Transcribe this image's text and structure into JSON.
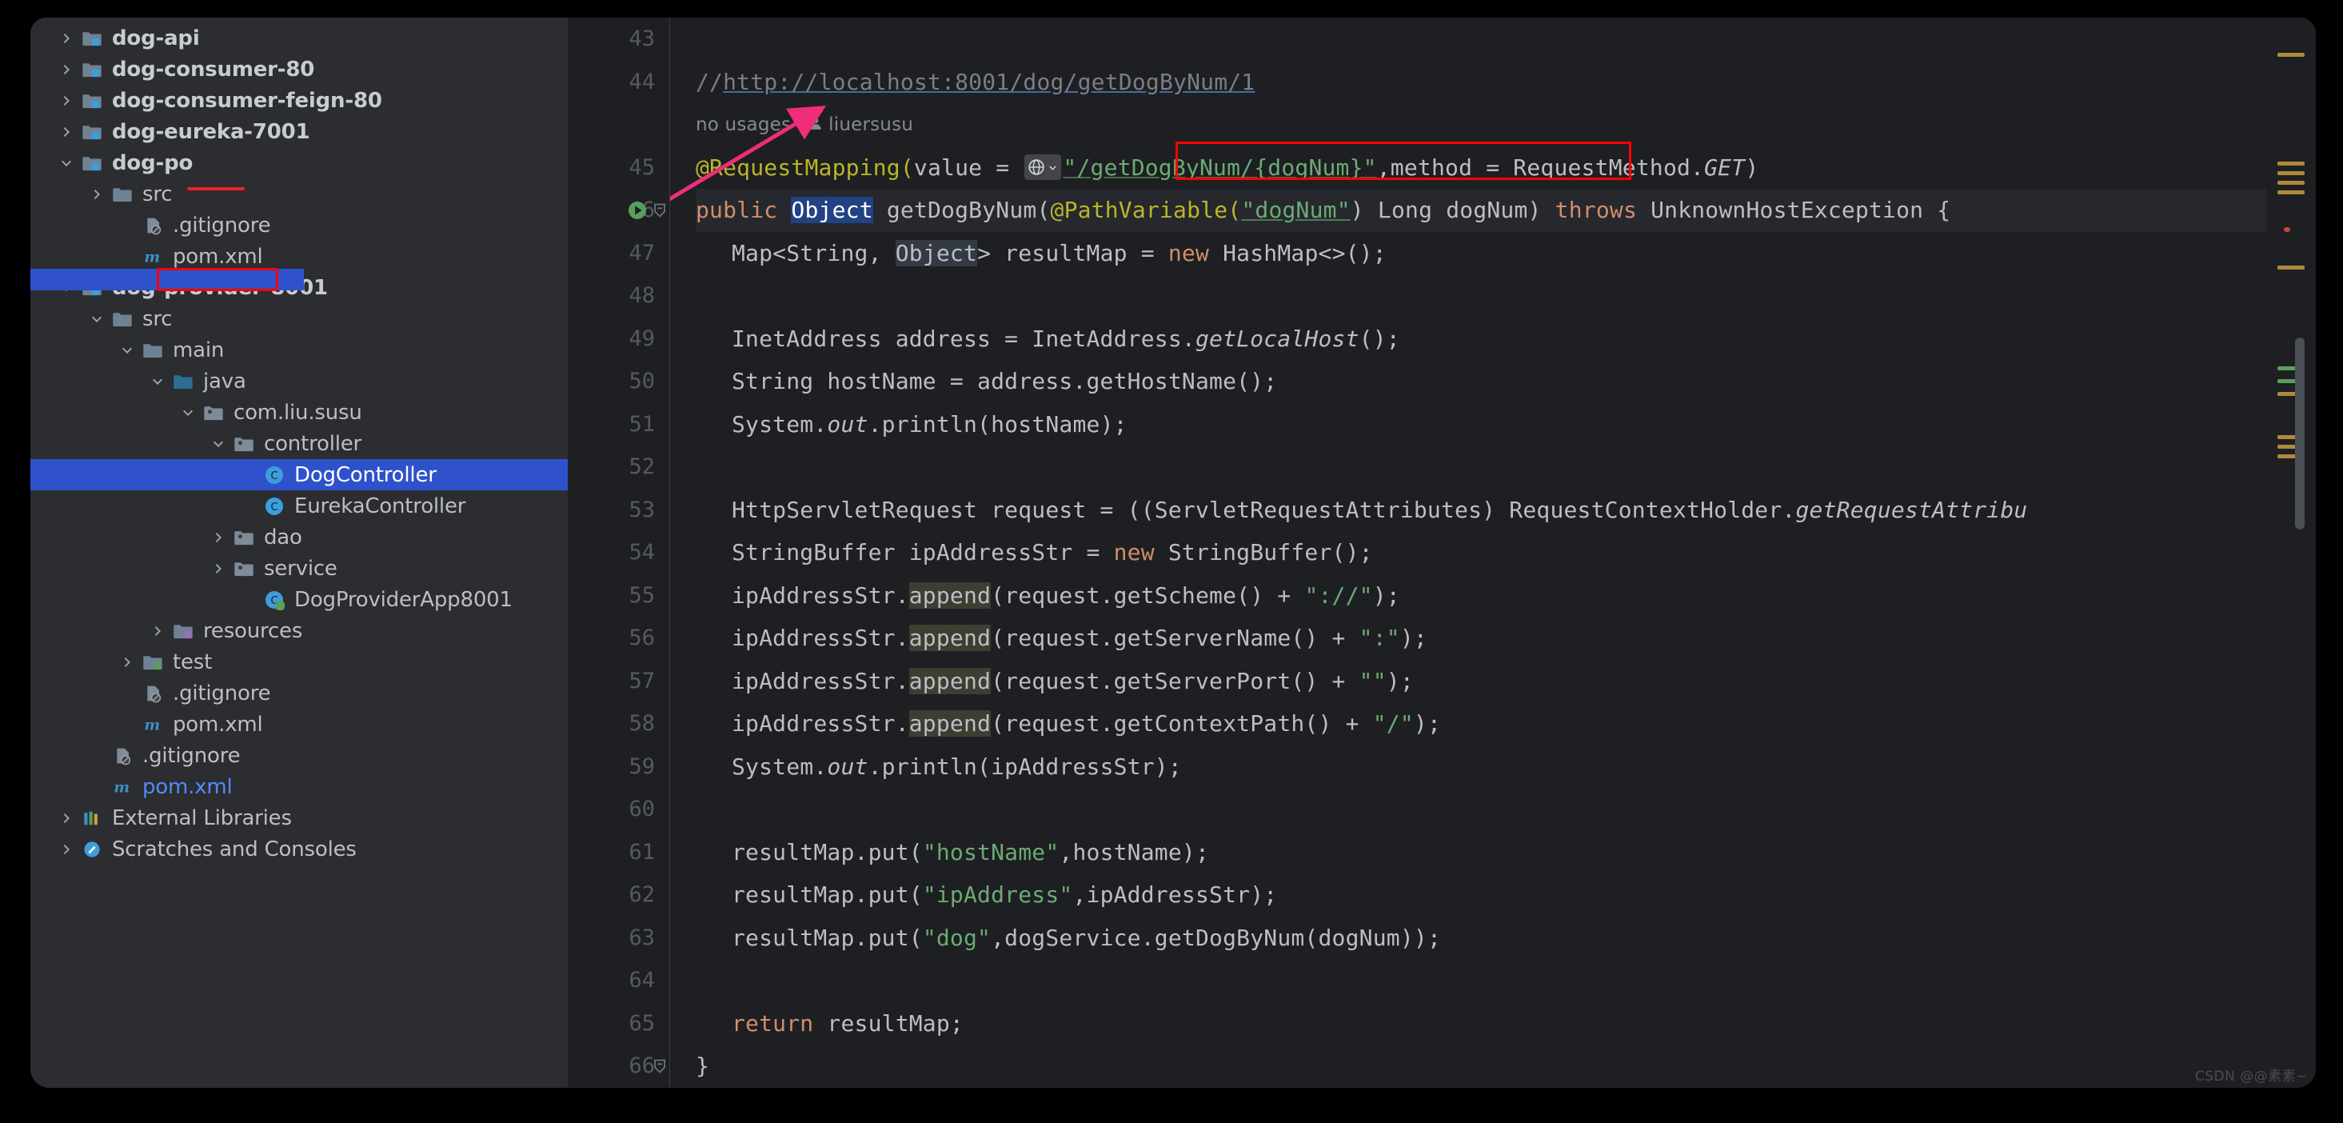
{
  "sidebar": {
    "tree": [
      {
        "label": "dog-api",
        "indent": 0,
        "arrow": "right",
        "icon": "module-folder-icon",
        "bold": true,
        "selected": false
      },
      {
        "label": "dog-consumer-80",
        "indent": 0,
        "arrow": "right",
        "icon": "module-folder-icon",
        "bold": true,
        "selected": false
      },
      {
        "label": "dog-consumer-feign-80",
        "indent": 0,
        "arrow": "right",
        "icon": "module-folder-icon",
        "bold": true,
        "selected": false
      },
      {
        "label": "dog-eureka-7001",
        "indent": 0,
        "arrow": "right",
        "icon": "module-folder-icon",
        "bold": true,
        "selected": false
      },
      {
        "label": "dog-po",
        "indent": 0,
        "arrow": "down",
        "icon": "module-folder-icon",
        "bold": true,
        "selected": false
      },
      {
        "label": "src",
        "indent": 1,
        "arrow": "right",
        "icon": "folder-icon",
        "bold": false,
        "selected": false
      },
      {
        "label": ".gitignore",
        "indent": 2,
        "arrow": "none",
        "icon": "gitignore-icon",
        "bold": false,
        "selected": false
      },
      {
        "label": "pom.xml",
        "indent": 2,
        "arrow": "none",
        "icon": "maven-icon",
        "bold": false,
        "selected": false
      },
      {
        "label": "dog-provider-8001",
        "indent": 0,
        "arrow": "down",
        "icon": "module-folder-icon",
        "bold": true,
        "selected": false
      },
      {
        "label": "src",
        "indent": 1,
        "arrow": "down",
        "icon": "folder-icon",
        "bold": false,
        "selected": false
      },
      {
        "label": "main",
        "indent": 2,
        "arrow": "down",
        "icon": "folder-icon",
        "bold": false,
        "selected": false
      },
      {
        "label": "java",
        "indent": 3,
        "arrow": "down",
        "icon": "source-folder-icon",
        "bold": false,
        "selected": false
      },
      {
        "label": "com.liu.susu",
        "indent": 4,
        "arrow": "down",
        "icon": "package-icon",
        "bold": false,
        "selected": false
      },
      {
        "label": "controller",
        "indent": 5,
        "arrow": "down",
        "icon": "package-icon",
        "bold": false,
        "selected": false
      },
      {
        "label": "DogController",
        "indent": 6,
        "arrow": "none",
        "icon": "java-class-icon",
        "bold": false,
        "selected": true
      },
      {
        "label": "EurekaController",
        "indent": 6,
        "arrow": "none",
        "icon": "java-class-icon",
        "bold": false,
        "selected": false
      },
      {
        "label": "dao",
        "indent": 5,
        "arrow": "right",
        "icon": "package-icon",
        "bold": false,
        "selected": false
      },
      {
        "label": "service",
        "indent": 5,
        "arrow": "right",
        "icon": "package-icon",
        "bold": false,
        "selected": false
      },
      {
        "label": "DogProviderApp8001",
        "indent": 6,
        "arrow": "none",
        "icon": "spring-boot-class-icon",
        "bold": false,
        "selected": false
      },
      {
        "label": "resources",
        "indent": 3,
        "arrow": "right",
        "icon": "resources-folder-icon",
        "bold": false,
        "selected": false
      },
      {
        "label": "test",
        "indent": 2,
        "arrow": "right",
        "icon": "test-folder-icon",
        "bold": false,
        "selected": false
      },
      {
        "label": ".gitignore",
        "indent": 2,
        "arrow": "none",
        "icon": "gitignore-icon",
        "bold": false,
        "selected": false
      },
      {
        "label": "pom.xml",
        "indent": 2,
        "arrow": "none",
        "icon": "maven-icon",
        "bold": false,
        "selected": false
      },
      {
        "label": ".gitignore",
        "indent": 1,
        "arrow": "none",
        "icon": "gitignore-icon",
        "bold": false,
        "selected": false
      },
      {
        "label": "pom.xml",
        "indent": 1,
        "arrow": "none",
        "icon": "maven-icon",
        "bold": false,
        "selected": false,
        "blue": true
      },
      {
        "label": "External Libraries",
        "indent": 0,
        "arrow": "right",
        "icon": "external-libraries-icon",
        "bold": false,
        "selected": false
      },
      {
        "label": "Scratches and Consoles",
        "indent": 0,
        "arrow": "right",
        "icon": "scratches-icon",
        "bold": false,
        "selected": false
      }
    ]
  },
  "editor": {
    "first_line_number": 43,
    "gutter_numbers": [
      "43",
      "44",
      "",
      "45",
      "46",
      "47",
      "48",
      "49",
      "50",
      "51",
      "52",
      "53",
      "54",
      "55",
      "56",
      "57",
      "58",
      "59",
      "60",
      "61",
      "62",
      "63",
      "64",
      "65",
      "66"
    ],
    "lines": [
      {
        "num": "44",
        "type": "code",
        "kind": "comment-url",
        "text": "//http://localhost:8001/dog/getDogByNum/1"
      },
      {
        "num": "",
        "type": "hint",
        "usages": "no usages",
        "author": "liuersusu"
      },
      {
        "num": "45",
        "type": "code",
        "kind": "request-mapping",
        "prefix": "@RequestMapping(",
        "param": "value = ",
        "globe": "globe-icon",
        "chevron": "chevron-down-icon",
        "value": "\"/getDogByNum/{dogNum}\"",
        "suffix": ",method = RequestMethod.",
        "enum": "GET",
        "close": ")"
      },
      {
        "num": "46",
        "type": "code",
        "kind": "signature",
        "modifier": "public ",
        "return_type": "Object",
        "name": " getDogByNum(",
        "annotation": "@PathVariable(",
        "ann_value": "\"dogNum\"",
        "rest": ") Long dogNum) ",
        "throws_kw": "throws ",
        "exception": "UnknownHostException {"
      },
      {
        "num": "47",
        "type": "code",
        "kind": "plain",
        "text": "Map<String, Object> resultMap = new HashMap<>();"
      },
      {
        "num": "48",
        "type": "code",
        "kind": "blank",
        "text": ""
      },
      {
        "num": "49",
        "type": "code",
        "kind": "plain",
        "text": "InetAddress address = InetAddress.getLocalHost();"
      },
      {
        "num": "50",
        "type": "code",
        "kind": "plain",
        "text": "String hostName = address.getHostName();"
      },
      {
        "num": "51",
        "type": "code",
        "kind": "plain",
        "text": "System.out.println(hostName);"
      },
      {
        "num": "52",
        "type": "code",
        "kind": "blank",
        "text": ""
      },
      {
        "num": "53",
        "type": "code",
        "kind": "plain",
        "text": "HttpServletRequest request = ((ServletRequestAttributes) RequestContextHolder.getRequestAttribu"
      },
      {
        "num": "54",
        "type": "code",
        "kind": "plain",
        "text": "StringBuffer ipAddressStr = new StringBuffer();"
      },
      {
        "num": "55",
        "type": "code",
        "kind": "plain",
        "text": "ipAddressStr.append(request.getScheme() + \"://\");"
      },
      {
        "num": "56",
        "type": "code",
        "kind": "plain",
        "text": "ipAddressStr.append(request.getServerName() + \":\");"
      },
      {
        "num": "57",
        "type": "code",
        "kind": "plain",
        "text": "ipAddressStr.append(request.getServerPort() + \"\");"
      },
      {
        "num": "58",
        "type": "code",
        "kind": "plain",
        "text": "ipAddressStr.append(request.getContextPath() + \"/\");"
      },
      {
        "num": "59",
        "type": "code",
        "kind": "plain",
        "text": "System.out.println(ipAddressStr);"
      },
      {
        "num": "60",
        "type": "code",
        "kind": "blank",
        "text": ""
      },
      {
        "num": "61",
        "type": "code",
        "kind": "plain",
        "text": "resultMap.put(\"hostName\",hostName);"
      },
      {
        "num": "62",
        "type": "code",
        "kind": "plain",
        "text": "resultMap.put(\"ipAddress\",ipAddressStr);"
      },
      {
        "num": "63",
        "type": "code",
        "kind": "plain",
        "text": "resultMap.put(\"dog\",dogService.getDogByNum(dogNum));"
      },
      {
        "num": "64",
        "type": "code",
        "kind": "blank",
        "text": ""
      },
      {
        "num": "65",
        "type": "code",
        "kind": "plain",
        "text": "return resultMap;"
      },
      {
        "num": "66",
        "type": "code",
        "kind": "plain",
        "text": "}"
      }
    ],
    "hint_usages": "no usages",
    "hint_author": "liuersusu"
  },
  "code_text": {
    "l44_comment": "//",
    "l44_url": "http://localhost:8001/dog/getDogByNum/1",
    "l45_annotation": "@RequestMapping(",
    "l45_param": "value",
    "l45_eq": " = ",
    "l45_string": "\"/getDogByNum/{dogNum}\"",
    "l45_tail": ",method = RequestMethod.",
    "l45_enum": "GET",
    "l45_close": ")",
    "l46_public": "public ",
    "l46_object": "Object",
    "l46_name": " getDogByNum(",
    "l46_pathvar": "@PathVariable(",
    "l46_dognum_str": "\"dogNum\"",
    "l46_params": ") Long dogNum) ",
    "l46_throws": "throws ",
    "l46_exc": "UnknownHostException {",
    "l47_a": "Map<String, ",
    "l47_obj": "Object",
    "l47_b": "> resultMap = ",
    "l47_new": "new ",
    "l47_c": "HashMap<>();",
    "l49_a": "InetAddress address = InetAddress.",
    "l49_m": "getLocalHost",
    "l49_b": "();",
    "l50": "String hostName = address.getHostName();",
    "l51_a": "System.",
    "l51_out": "out",
    "l51_b": ".println(hostName);",
    "l53": "HttpServletRequest request = ((ServletRequestAttributes) RequestContextHolder.",
    "l53_m": "getRequestAttribu",
    "l54_a": "StringBuffer ipAddressStr = ",
    "l54_new": "new ",
    "l54_b": "StringBuffer();",
    "l55_a": "ipAddressStr.",
    "l55_m": "append",
    "l55_b": "(request.getScheme() + ",
    "l55_s": "\"://\"",
    "l55_c": ");",
    "l56_b": "(request.getServerName() + ",
    "l56_s": "\":\"",
    "l57_b": "(request.getServerPort() + ",
    "l57_s": "\"\"",
    "l58_b": "(request.getContextPath() + ",
    "l58_s": "\"/\"",
    "l59_a": "System.",
    "l59_out": "out",
    "l59_b": ".println(ipAddressStr);",
    "l61_a": "resultMap.put(",
    "l61_s": "\"hostName\"",
    "l61_b": ",hostName);",
    "l62_s": "\"ipAddress\"",
    "l62_b": ",ipAddressStr);",
    "l63_s": "\"dog\"",
    "l63_b": ",dogService.getDogByNum(dogNum));",
    "l65_return": "return ",
    "l65_b": "resultMap;",
    "l66": "}"
  },
  "colors": {
    "accent_selection": "#2f52cc",
    "annotation_red": "#ff0000",
    "arrow_pink": "#ef2d7a",
    "keyword": "#cf8e6d",
    "string": "#6aab73",
    "annotation_yellow": "#bbb529",
    "background_editor": "#1e1f22",
    "background_sidebar": "#2b2d30"
  },
  "watermark": "CSDN @@素素~"
}
